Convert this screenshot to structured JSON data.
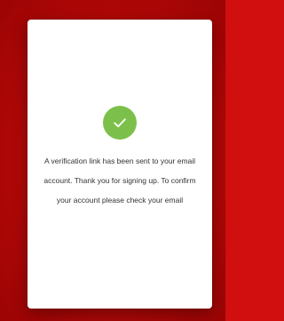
{
  "verification": {
    "icon": "check-icon",
    "accent_color": "#7cc04b",
    "background_color": "#c20c0c",
    "message": "A verification link has been sent to your email account. Thank you for signing up. To confirm your account please check your email"
  }
}
